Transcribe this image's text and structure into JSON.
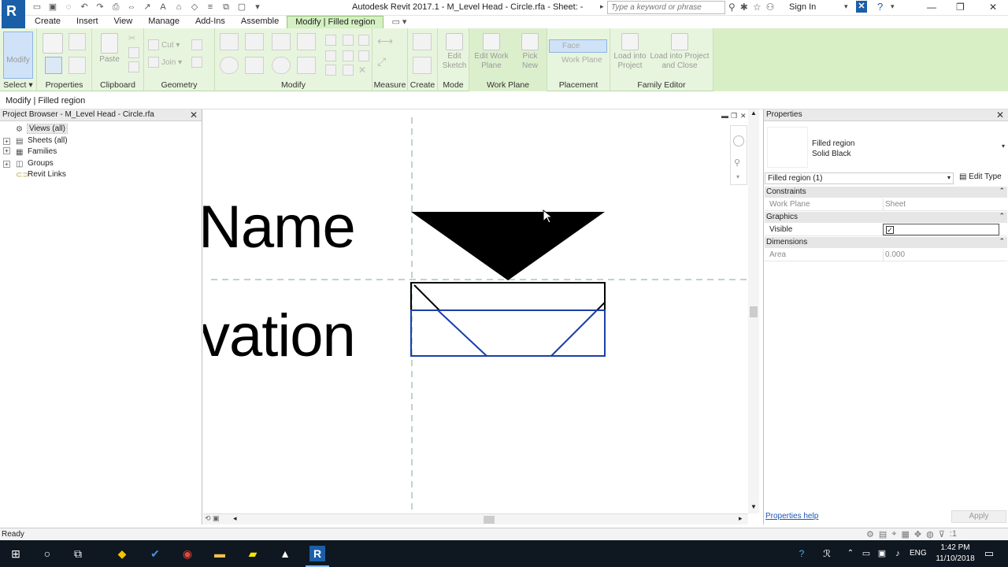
{
  "title_bar": {
    "logo": "R",
    "window_title": "Autodesk Revit 2017.1 -    M_Level Head - Circle.rfa - Sheet:  -",
    "search_placeholder": "Type a keyword or phrase",
    "sign_in": "Sign In"
  },
  "ribbon_tabs": [
    {
      "label": "Create"
    },
    {
      "label": "Insert"
    },
    {
      "label": "View"
    },
    {
      "label": "Manage"
    },
    {
      "label": "Add-Ins"
    },
    {
      "label": "Assemble"
    },
    {
      "label": "Modify | Filled region",
      "active": true
    }
  ],
  "ribbon": {
    "panels": {
      "select": "Select",
      "properties": "Properties",
      "clipboard": "Clipboard",
      "geometry": "Geometry",
      "modify": "Modify",
      "measure": "Measure",
      "create": "Create",
      "mode": "Mode",
      "work_plane": "Work Plane",
      "placement": "Placement",
      "family_editor": "Family Editor"
    },
    "buttons": {
      "modify": "Modify",
      "paste": "Paste",
      "cut": "Cut",
      "join": "Join",
      "edit_sketch": "Edit Sketch",
      "edit_work_plane": "Edit Work Plane",
      "pick_new": "Pick New",
      "face": "Face",
      "work_plane": "Work Plane",
      "load_into_project": "Load into Project",
      "load_into_project_close": "Load into Project and Close"
    }
  },
  "options_bar": {
    "label": "Modify | Filled region"
  },
  "project_browser": {
    "title": "Project Browser - M_Level Head - Circle.rfa",
    "items": [
      {
        "label": "Views (all)",
        "expander": "",
        "icon": "views-icon"
      },
      {
        "label": "Sheets (all)",
        "expander": "+",
        "icon": "sheets-icon"
      },
      {
        "label": "Families",
        "expander": "+",
        "icon": "families-icon"
      },
      {
        "label": "Groups",
        "expander": "+",
        "icon": "groups-icon"
      },
      {
        "label": "Revit Links",
        "expander": "",
        "icon": "revit-links-icon"
      }
    ]
  },
  "canvas": {
    "text_name": "Name",
    "text_elevation": "vation"
  },
  "properties": {
    "title": "Properties",
    "type_name_line1": "Filled region",
    "type_name_line2": "Solid Black",
    "instance_filter": "Filled region (1)",
    "edit_type": "Edit Type",
    "groups": {
      "constraints": "Constraints",
      "graphics": "Graphics",
      "dimensions": "Dimensions"
    },
    "rows": {
      "work_plane": {
        "name": "Work Plane",
        "value": "Sheet"
      },
      "visible": {
        "name": "Visible",
        "checked": true
      },
      "area": {
        "name": "Area",
        "value": "0.000"
      }
    },
    "help_link": "Properties help",
    "apply": "Apply"
  },
  "status_bar": {
    "text": "Ready",
    "filter_count": ":1"
  },
  "taskbar": {
    "language": "ENG",
    "time": "1:42 PM",
    "date": "11/10/2018"
  }
}
